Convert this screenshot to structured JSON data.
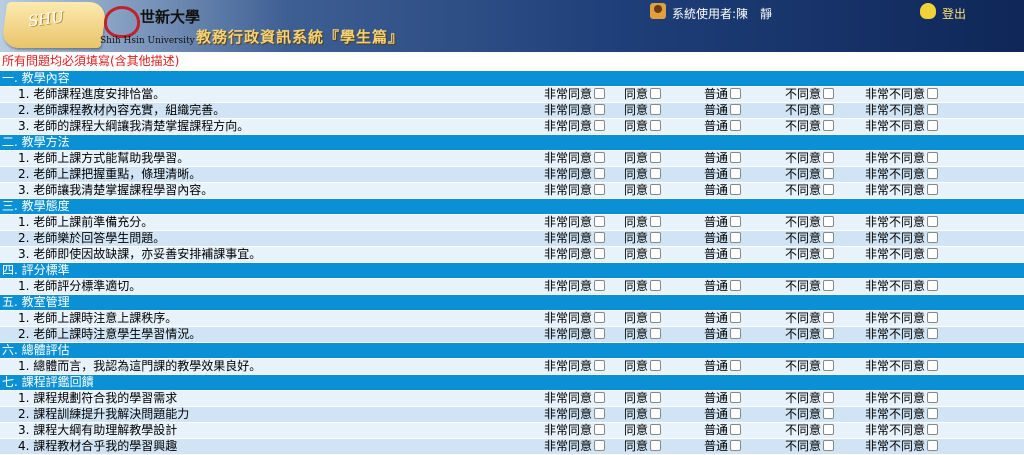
{
  "header": {
    "scroll_text": "SHU",
    "logo_cn": "世新大學",
    "logo_en": "Shih Hsin University",
    "system_title": "教務行政資訊系統『學生篇』",
    "user_label": "系統使用者:陳　靜",
    "logout": "登出"
  },
  "notice": "所有問題均必須填寫(含其他描述)",
  "options": [
    "非常同意",
    "同意",
    "普通",
    "不同意",
    "非常不同意"
  ],
  "sections": [
    {
      "title": "一. 教學內容",
      "questions": [
        "1. 老師課程進度安排恰當。",
        "2. 老師課程教材內容充實，組織完善。",
        "3. 老師的課程大綱讓我清楚掌握課程方向。"
      ]
    },
    {
      "title": "二. 教學方法",
      "questions": [
        "1. 老師上課方式能幫助我學習。",
        "2. 老師上課把握重點，條理清晰。",
        "3. 老師讓我清楚掌握課程學習內容。"
      ]
    },
    {
      "title": "三. 教學態度",
      "questions": [
        "1. 老師上課前準備充分。",
        "2. 老師樂於回答學生問題。",
        "3. 老師即使因故缺課，亦妥善安排補課事宜。"
      ]
    },
    {
      "title": "四. 評分標準",
      "questions": [
        "1. 老師評分標準適切。"
      ]
    },
    {
      "title": "五. 教室管理",
      "questions": [
        "1. 老師上課時注意上課秩序。",
        "2. 老師上課時注意學生學習情況。"
      ]
    },
    {
      "title": "六. 總體評估",
      "questions": [
        "1. 總體而言，我認為這門課的教學效果良好。"
      ]
    },
    {
      "title": "七. 課程評鑑回饋",
      "questions": [
        "1. 課程規劃符合我的學習需求",
        "2. 課程訓練提升我解決問題能力",
        "3. 課程大綱有助理解教學設計",
        "4. 課程教材合乎我的學習興趣"
      ]
    }
  ]
}
